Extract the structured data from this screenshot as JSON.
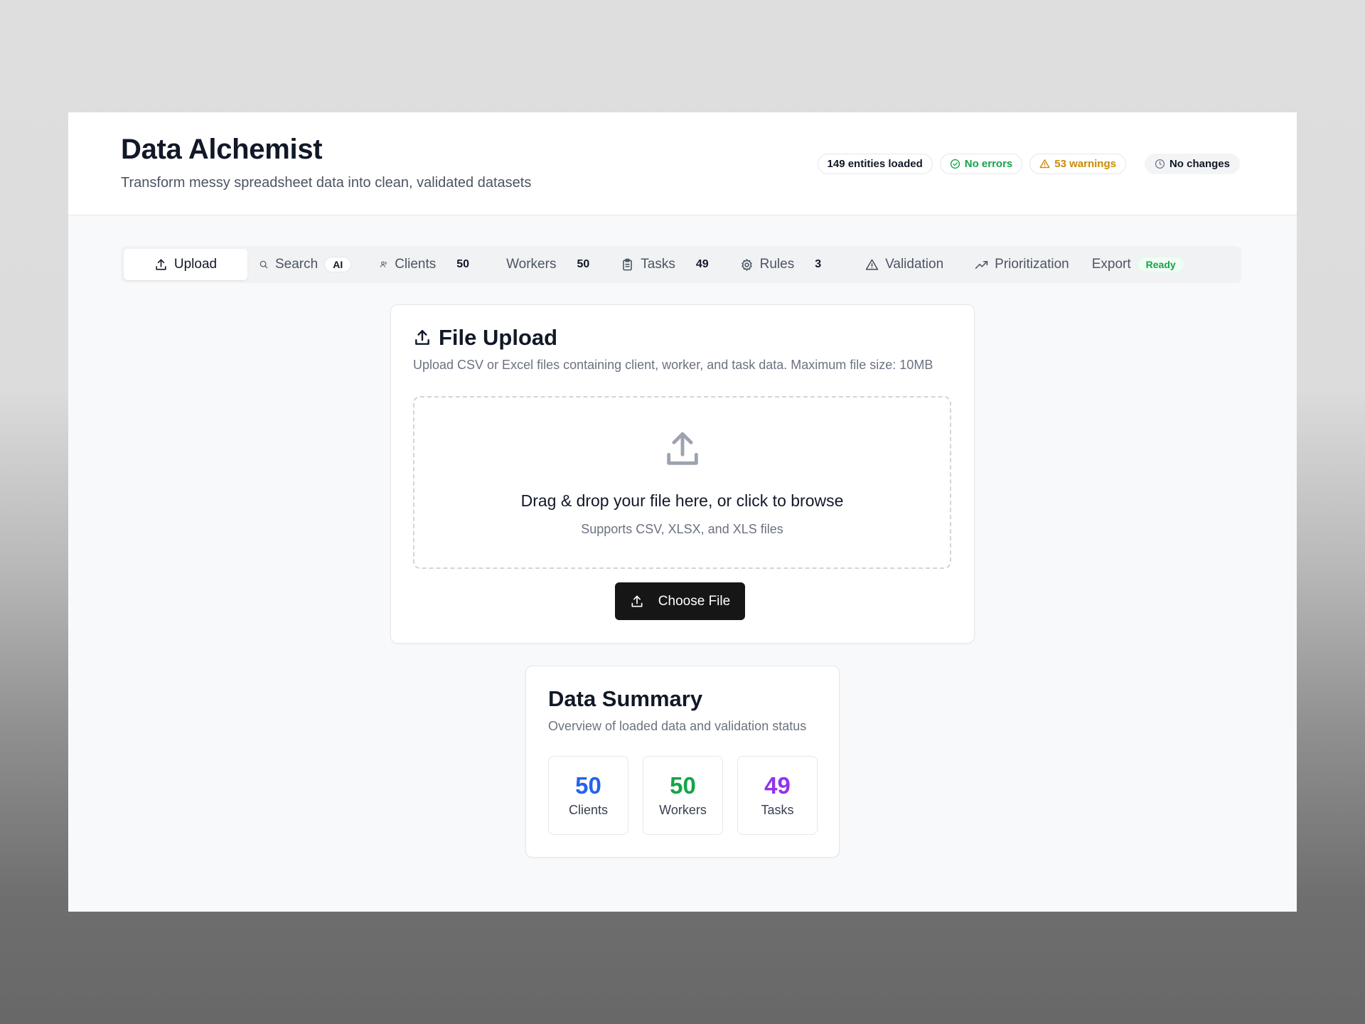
{
  "app": {
    "title": "Data Alchemist",
    "subtitle": "Transform messy spreadsheet data into clean, validated datasets"
  },
  "status": {
    "entities": "149 entities loaded",
    "errors": "No errors",
    "warnings": "53 warnings",
    "changes": "No changes"
  },
  "tabs": [
    {
      "label": "Upload",
      "icon": "upload-icon"
    },
    {
      "label": "Search",
      "icon": "search-icon",
      "pill": "AI"
    },
    {
      "label": "Clients",
      "icon": "users-icon",
      "count": "50"
    },
    {
      "label": "Workers",
      "count": "50"
    },
    {
      "label": "Tasks",
      "icon": "clipboard-icon",
      "count": "49"
    },
    {
      "label": "Rules",
      "icon": "gear-icon",
      "count": "3"
    },
    {
      "label": "Validation",
      "icon": "warning-icon"
    },
    {
      "label": "Prioritization",
      "icon": "trending-up-icon"
    },
    {
      "label": "Export",
      "pill": "Ready"
    }
  ],
  "upload": {
    "title": "File Upload",
    "description": "Upload CSV or Excel files containing client, worker, and task data. Maximum file size: 10MB",
    "drop_title": "Drag & drop your file here, or click to browse",
    "drop_sub": "Supports CSV, XLSX, and XLS files",
    "button": "Choose File"
  },
  "summary": {
    "title": "Data Summary",
    "description": "Overview of loaded data and validation status",
    "stats": [
      {
        "value": "50",
        "label": "Clients",
        "color": "#2563eb"
      },
      {
        "value": "50",
        "label": "Workers",
        "color": "#16a34a"
      },
      {
        "value": "49",
        "label": "Tasks",
        "color": "#9333ea"
      }
    ]
  },
  "colors": {
    "success": "#16a34a",
    "warning": "#ca8a04",
    "primary_button": "#161616"
  }
}
